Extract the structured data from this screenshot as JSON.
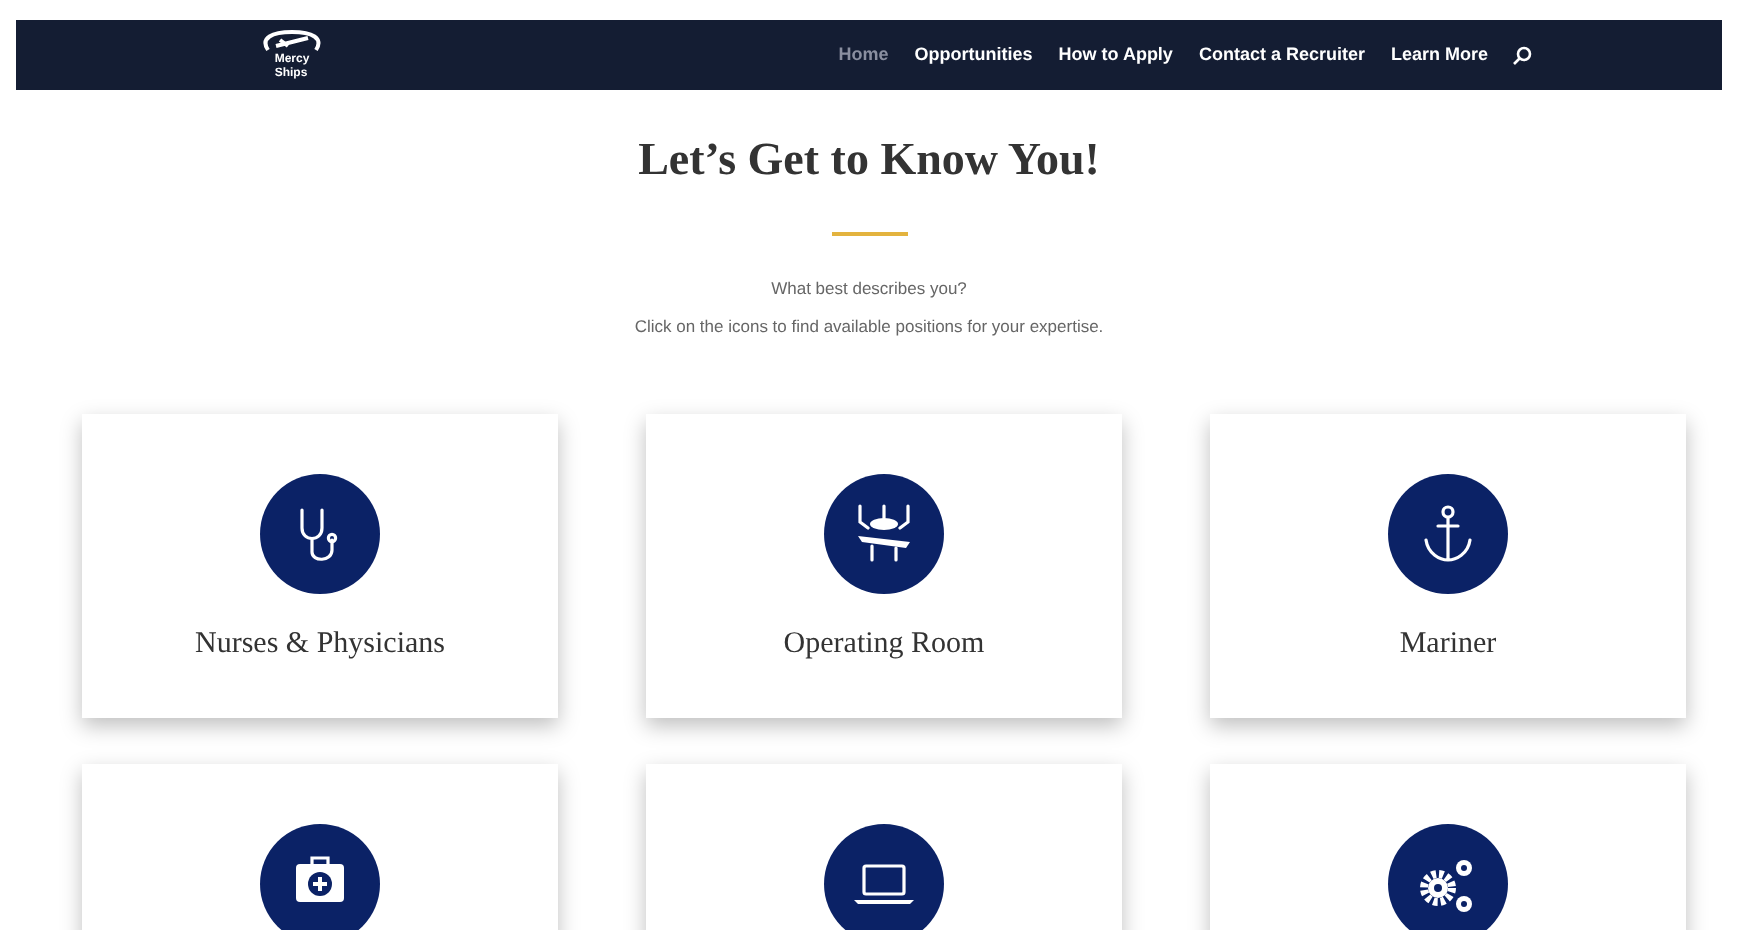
{
  "nav": {
    "logo_text": [
      "Mercy",
      "Ships"
    ],
    "items": [
      {
        "label": "Home",
        "selected": true
      },
      {
        "label": "Opportunities",
        "selected": false
      },
      {
        "label": "How to Apply",
        "selected": false
      },
      {
        "label": "Contact a Recruiter",
        "selected": false
      },
      {
        "label": "Learn More",
        "selected": false
      }
    ]
  },
  "heading": "Let’s Get to Know You!",
  "intro": [
    "What best describes you?",
    "Click on the icons to find available positions for your expertise."
  ],
  "cards": [
    {
      "kind": "titled",
      "label": "Nurses & Physicians"
    },
    {
      "kind": "titled",
      "label": "Operating Room"
    },
    {
      "kind": "titled",
      "label": "Mariner"
    },
    {
      "kind": "cut_off"
    },
    {
      "kind": "cut_off"
    },
    {
      "kind": "cut_off"
    }
  ]
}
